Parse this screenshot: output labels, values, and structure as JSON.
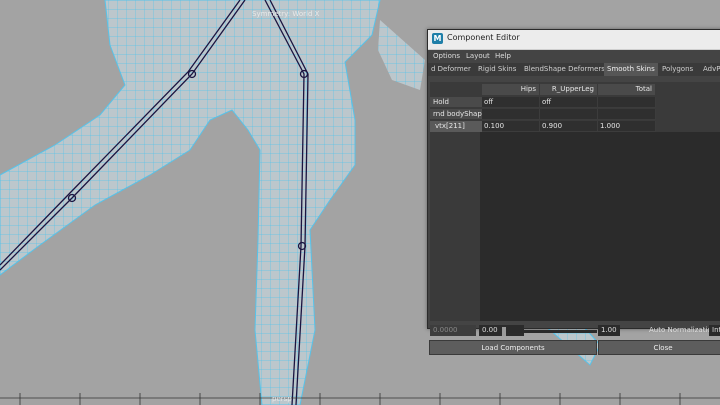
{
  "viewport": {
    "title": "Symmetry: World X",
    "camera": "persp"
  },
  "window": {
    "title": "Component Editor",
    "icon": "maya-icon",
    "menus": [
      "Options",
      "Layout",
      "Help"
    ],
    "tabs": [
      "d Deformer",
      "Rigid Skins",
      "BlendShape Deformers",
      "Smooth Skins",
      "Polygons",
      "AdvPo"
    ],
    "active_tab": "Smooth Skins"
  },
  "table": {
    "columns": [
      "Hips",
      "R_UpperLeg",
      "Total"
    ],
    "rows": [
      {
        "label": "Hold",
        "values": [
          "off",
          "off",
          ""
        ]
      },
      {
        "label": "rnd bodyShape",
        "values": [
          "",
          "",
          ""
        ]
      },
      {
        "label": "vtx[211]",
        "values": [
          "0.100",
          "0.900",
          "1.000"
        ]
      }
    ]
  },
  "bottom": {
    "min_value": "0.0000",
    "current_value": "0.00",
    "max_value": "1.00",
    "auto_normalization_label": "Auto Normalization",
    "auto_normalization_value": "Inte"
  },
  "buttons": {
    "load": "Load Components",
    "close": "Close"
  },
  "colors": {
    "mesh": "#bcc7cc",
    "mesh_edges": "#56c3ea",
    "bones": "#1b1440",
    "viewport_bg": "#a3a3a3"
  }
}
